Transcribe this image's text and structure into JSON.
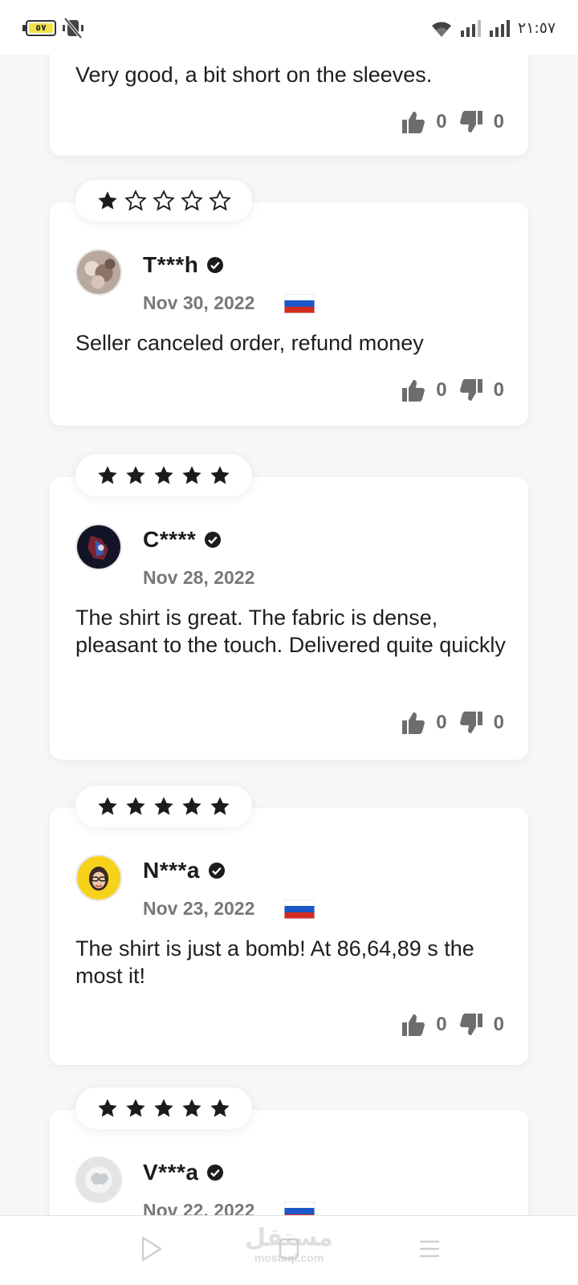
{
  "status_bar": {
    "time": "٢١:٥٧",
    "battery_label": "٥٧",
    "icons": [
      "battery-icon",
      "mute-icon",
      "wifi-icon",
      "signal-icon",
      "signal-icon"
    ]
  },
  "icons": {
    "star": "star-icon",
    "verified": "verified-check-icon",
    "thumbs_up": "thumbs-up-icon",
    "thumbs_down": "thumbs-down-icon",
    "flag": "russia-flag-icon"
  },
  "colors": {
    "star": "#1c1c1c",
    "date": "#787878",
    "vote": "#6d6d6d"
  },
  "reviews": [
    {
      "text": "Very good, a bit short on the sleeves.",
      "likes": "0",
      "dislikes": "0"
    },
    {
      "rating": 1,
      "name": "T***h",
      "date": "Nov 30, 2022",
      "country": "Russia",
      "text": "Seller canceled order, refund money",
      "likes": "0",
      "dislikes": "0"
    },
    {
      "rating": 5,
      "name": "C****",
      "date": "Nov 28, 2022",
      "text": "The shirt is great. The fabric is dense, pleasant to the touch. Delivered quite quickly",
      "likes": "0",
      "dislikes": "0"
    },
    {
      "rating": 5,
      "name": "N***a",
      "date": "Nov 23, 2022",
      "country": "Russia",
      "text": "The shirt is just a bomb! At 86,64,89 s the most it!",
      "likes": "0",
      "dislikes": "0"
    },
    {
      "rating": 5,
      "name": "V***a",
      "date": "Nov 22, 2022",
      "country": "Russia"
    }
  ],
  "bottom_nav": {
    "watermark": "مستقل",
    "watermark_sub": "mostaql.com",
    "icons": [
      "back-icon",
      "home-icon",
      "menu-icon"
    ]
  }
}
